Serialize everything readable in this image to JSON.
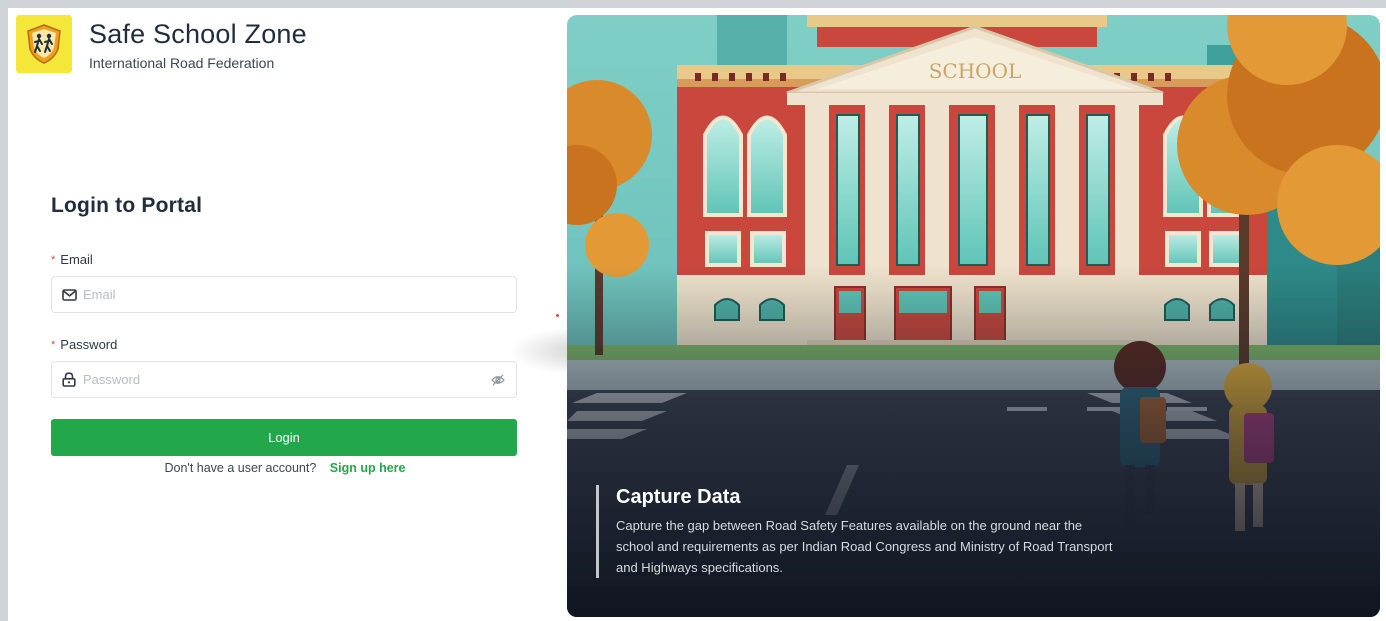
{
  "brand": {
    "title": "Safe School Zone",
    "subtitle": "International Road Federation",
    "logo_icon": "children-crossing-shield-icon",
    "logo_bg": "#f5e63a"
  },
  "login": {
    "title": "Login to Portal",
    "email_label": "Email",
    "email_placeholder": "Email",
    "email_icon": "envelope-icon",
    "password_label": "Password",
    "password_placeholder": "Password",
    "password_icon": "lock-icon",
    "visibility_icon": "eye-hidden-icon",
    "button_label": "Login",
    "signup_prompt": "Don't have a user account?",
    "signup_link": "Sign up here",
    "accent_color": "#22a74a"
  },
  "hero": {
    "building_sign": "SCHOOL",
    "caption_title": "Capture Data",
    "caption_text": "Capture the gap between Road Safety Features available on the ground near the school and requirements as per Indian Road Congress and Ministry of Road Transport and Highways specifications."
  }
}
